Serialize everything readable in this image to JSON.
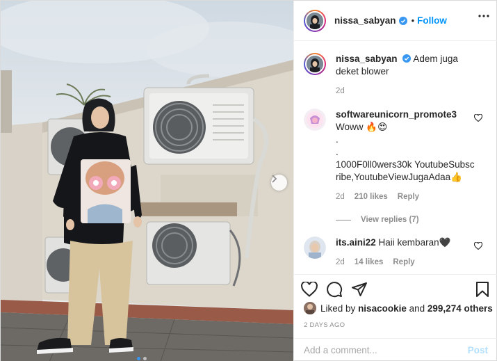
{
  "post": {
    "username": "nissa_sabyan",
    "follow_label": "Follow",
    "separator": "•"
  },
  "caption": {
    "username": "nissa_sabyan",
    "text": "Adem juga deket blower",
    "age": "2d"
  },
  "comments": [
    {
      "username": "softwareunicorn_promote3",
      "lines": [
        "Woww 🔥😍",
        ".",
        ".",
        "1000F0ll0wers30k YoutubeSubscribe,YoutubeViewJugaAdaa👍"
      ],
      "age": "2d",
      "likes": "210 likes",
      "reply_label": "Reply",
      "view_replies": "View replies (7)"
    },
    {
      "username": "its.aini22",
      "text": "Haii kembaran🖤",
      "age": "2d",
      "likes": "14 likes",
      "reply_label": "Reply"
    }
  ],
  "likes_summary": {
    "prefix": "Liked by",
    "user": "nisacookie",
    "middle": "and",
    "others": "299,274 others"
  },
  "timestamp": "2 DAYS AGO",
  "add_comment": {
    "placeholder": "Add a comment...",
    "post_label": "Post"
  },
  "carousel": {
    "total": 2,
    "current": 1
  },
  "colors": {
    "accent": "#0095f6",
    "verified": "#3897f0",
    "muted": "#8e8e8e"
  },
  "icons": [
    "verified-badge-icon",
    "more-options-icon",
    "heart-icon",
    "comment-icon",
    "share-icon",
    "bookmark-icon",
    "chevron-right-icon"
  ]
}
